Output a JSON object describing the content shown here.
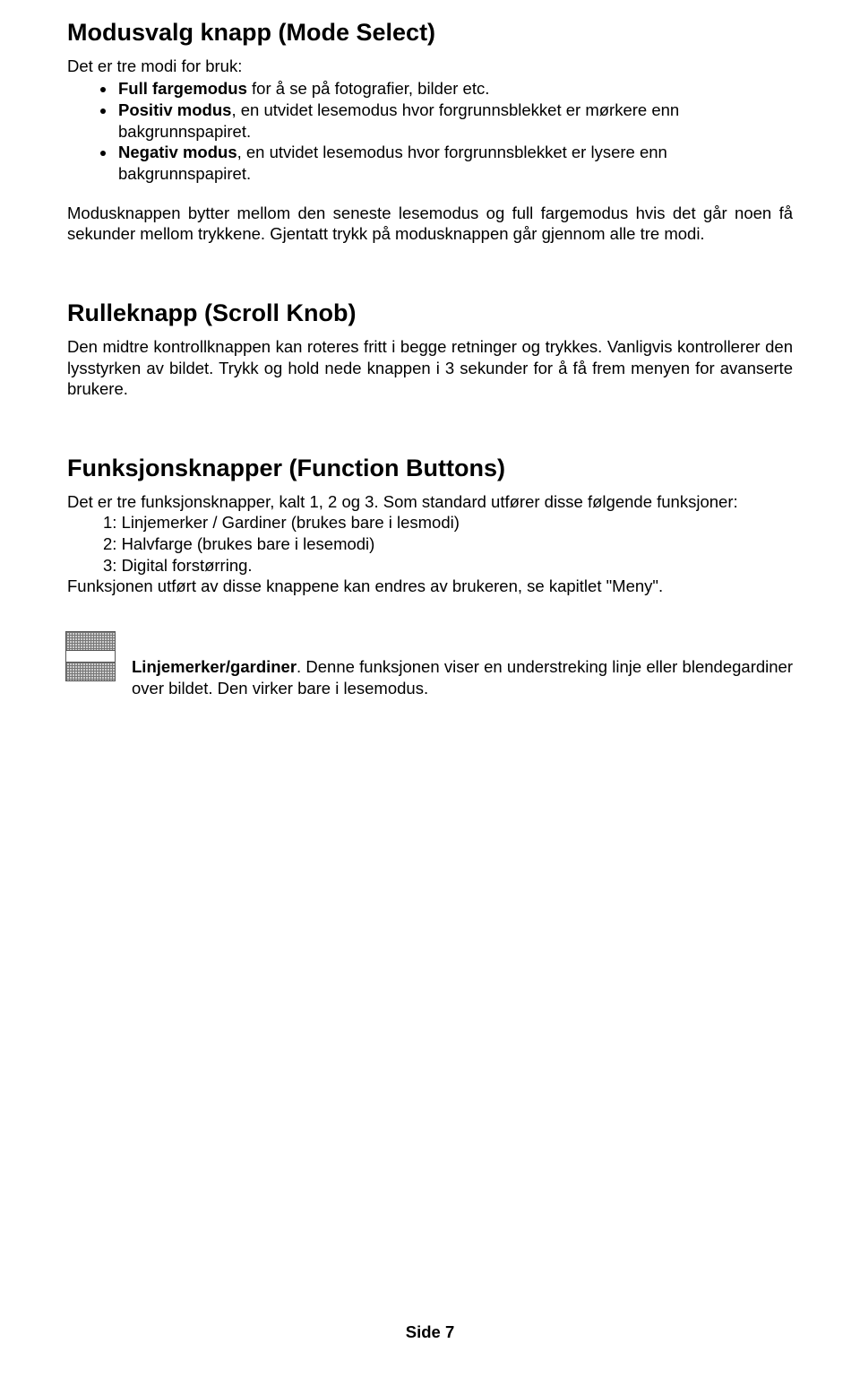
{
  "section1": {
    "heading": "Modusvalg knapp (Mode Select)",
    "intro": "Det er tre modi for bruk:",
    "bullets": [
      {
        "bold": "Full fargemodus",
        "rest": " for å se på fotografier, bilder etc."
      },
      {
        "bold": "Positiv modus",
        "rest": ", en utvidet lesemodus hvor forgrunnsblekket er mørkere enn bakgrunnspapiret."
      },
      {
        "bold": "Negativ modus",
        "rest": ", en utvidet lesemodus hvor forgrunnsblekket er lysere enn bakgrunnspapiret."
      }
    ],
    "para": "Modusknappen bytter mellom den seneste lesemodus og full fargemodus hvis det går noen få sekunder mellom trykkene.  Gjentatt trykk på modusknappen går gjennom alle tre modi."
  },
  "section2": {
    "heading": "Rulleknapp (Scroll Knob)",
    "para": "Den midtre kontrollknappen kan roteres fritt i begge retninger og trykkes. Vanligvis kontrollerer den lysstyrken av bildet.  Trykk og hold nede knappen i 3 sekunder for å få frem menyen for avanserte brukere."
  },
  "section3": {
    "heading": "Funksjonsknapper (Function Buttons)",
    "intro": "Det er tre funksjonsknapper, kalt 1, 2 og 3. Som standard utfører disse følgende funksjoner:",
    "items": [
      "1: Linjemerker / Gardiner (brukes bare i lesmodi)",
      "2: Halvfarge (brukes bare i lesemodi)",
      "3: Digital forstørring."
    ],
    "closing": "Funksjonen utført av disse knappene kan endres av brukeren, se kapitlet \"Meny\".",
    "icon_label_bold": "Linjemerker/gardiner",
    "icon_label_rest": ".  Denne funksjonen viser en understreking linje eller blendegardiner over bildet.  Den virker bare i lesemodus."
  },
  "footer": "Side 7"
}
